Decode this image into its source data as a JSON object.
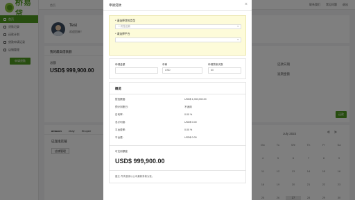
{
  "app": {
    "logo_text": "桥易贷",
    "brand_color": "#4e9a1e"
  },
  "sidebar": {
    "items": [
      {
        "label": "首页",
        "icon": "home-icon",
        "active": true
      },
      {
        "label": "贷款记录",
        "icon": "document-icon"
      },
      {
        "label": "还款计划",
        "icon": "calendar-icon"
      },
      {
        "label": "贷款申请记录",
        "icon": "list-icon"
      },
      {
        "label": "店铺管理",
        "icon": "store-icon"
      }
    ],
    "apply_button": "申请贷款"
  },
  "topbar": {
    "breadcrumb": "首页",
    "links": [
      "联系我们",
      "常见问题",
      "退出"
    ]
  },
  "profile": {
    "name": "Test",
    "welcome": "欢迎回来！"
  },
  "credit_card": {
    "heading": "我的最高借款额",
    "label": "总额",
    "amount": "USD$ 999,900.00"
  },
  "right_card": {
    "label_a": "还款日期",
    "label_b": "逾期金额"
  },
  "hire_button": "还款",
  "shops": {
    "tabs": [
      "amazon",
      "ebay",
      "Shopee"
    ],
    "title": "已连接店铺",
    "add_button": "店铺管理"
  },
  "calendar": {
    "month": "July 2022",
    "arrow_left": "«",
    "arrow_right": "»",
    "days": [
      "Mo",
      "Tu",
      "We",
      "Th",
      "Fr",
      "Sa",
      "4",
      "5",
      "6",
      "7",
      "8",
      "9",
      "11",
      "12",
      "13",
      "14",
      "15",
      "16",
      "18",
      "19",
      "20",
      "21",
      "22",
      "23",
      "25",
      "26",
      "27",
      "28",
      "29",
      "30"
    ]
  },
  "modal": {
    "title": "申请贷款",
    "close": "×",
    "loan_type_label": "* 请选择贷款类型",
    "loan_type_placeholder": "一次性还款",
    "platform_label": "* 请选择平台",
    "platform_placeholder": "",
    "amount_label": "申请金额",
    "amount_value": "",
    "currency_label": "币种",
    "currency_value": "USD",
    "term_label": "申请贷款天数",
    "term_value": "60",
    "summary_title": "概览",
    "summary_rows": [
      {
        "label": "授信额度:",
        "value": "USD$ 1,000,000.00"
      },
      {
        "label": "预计到账日:",
        "value": "不适用"
      },
      {
        "label": "日利率:",
        "value": "0.00 %"
      },
      {
        "label": "总计利息:",
        "value": "USD$ 0.00"
      },
      {
        "label": "平台费率:",
        "value": "0.00 %"
      },
      {
        "label": "平台费:",
        "value": "USD$ 0.00"
      }
    ],
    "available_label": "可支用额度",
    "available_amount": "USD$ 999,900.00",
    "note": "备注: 所有费用以公司最新条款为准。"
  }
}
